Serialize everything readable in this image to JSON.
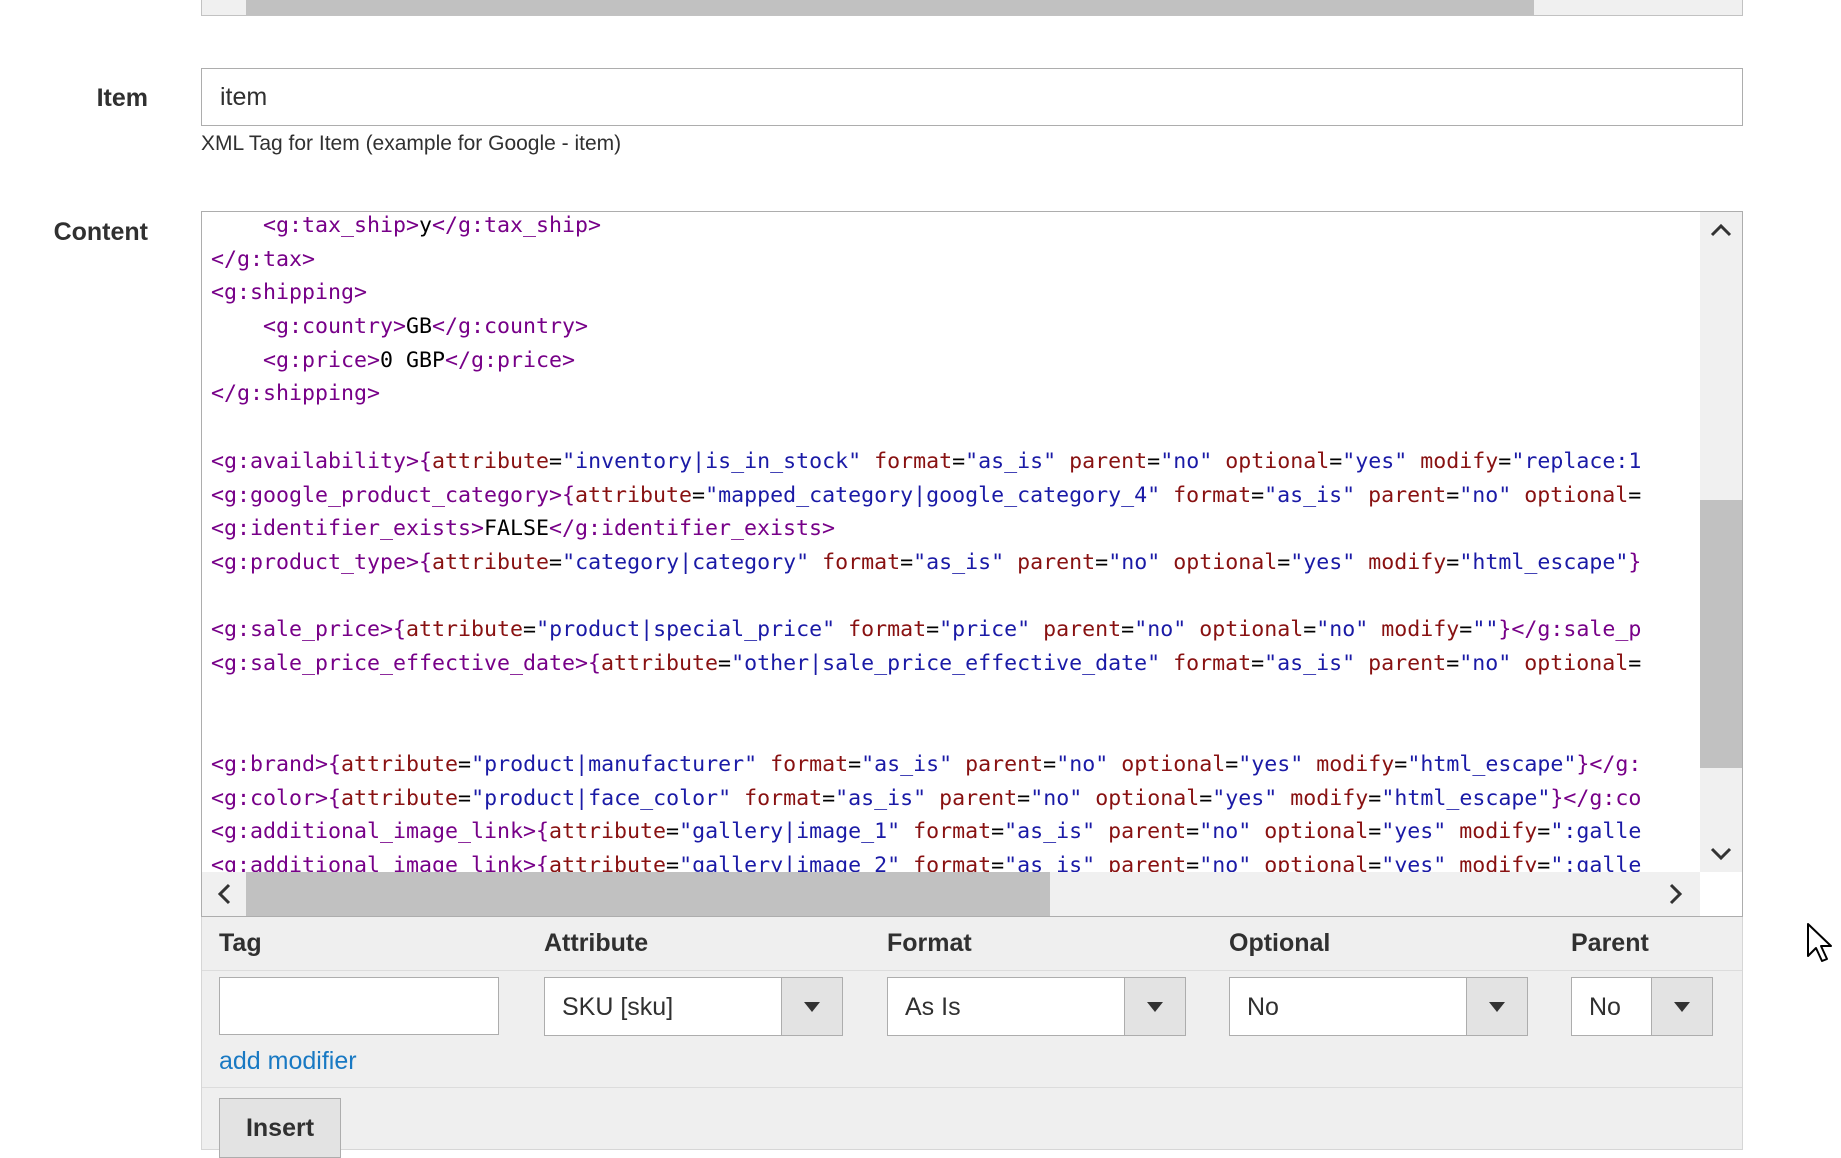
{
  "item_field": {
    "label": "Item",
    "value": "item",
    "note": "XML Tag for Item (example for Google - item)"
  },
  "content_field": {
    "label": "Content",
    "lines": [
      [
        {
          "t": "tag",
          "s": "    <g:tax_ship>"
        },
        {
          "t": "txt",
          "s": "y"
        },
        {
          "t": "tag",
          "s": "</g:tax_ship>"
        }
      ],
      [
        {
          "t": "tag",
          "s": "</g:tax>"
        }
      ],
      [
        {
          "t": "tag",
          "s": "<g:shipping>"
        }
      ],
      [
        {
          "t": "tag",
          "s": "    <g:country>"
        },
        {
          "t": "txt",
          "s": "GB"
        },
        {
          "t": "tag",
          "s": "</g:country>"
        }
      ],
      [
        {
          "t": "tag",
          "s": "    <g:price>"
        },
        {
          "t": "txt",
          "s": "0 GBP"
        },
        {
          "t": "tag",
          "s": "</g:price>"
        }
      ],
      [
        {
          "t": "tag",
          "s": "</g:shipping>"
        }
      ],
      [],
      [
        {
          "t": "tag",
          "s": "<g:availability>"
        },
        {
          "t": "brc",
          "s": "{"
        },
        {
          "t": "attr",
          "s": "attribute"
        },
        {
          "t": "eq",
          "s": "="
        },
        {
          "t": "str",
          "s": "\"inventory|is_in_stock\""
        },
        {
          "t": "txt",
          "s": " "
        },
        {
          "t": "attr",
          "s": "format"
        },
        {
          "t": "eq",
          "s": "="
        },
        {
          "t": "str",
          "s": "\"as_is\""
        },
        {
          "t": "txt",
          "s": " "
        },
        {
          "t": "attr",
          "s": "parent"
        },
        {
          "t": "eq",
          "s": "="
        },
        {
          "t": "str",
          "s": "\"no\""
        },
        {
          "t": "txt",
          "s": " "
        },
        {
          "t": "attr",
          "s": "optional"
        },
        {
          "t": "eq",
          "s": "="
        },
        {
          "t": "str",
          "s": "\"yes\""
        },
        {
          "t": "txt",
          "s": " "
        },
        {
          "t": "attr",
          "s": "modify"
        },
        {
          "t": "eq",
          "s": "="
        },
        {
          "t": "str",
          "s": "\"replace:1"
        }
      ],
      [
        {
          "t": "tag",
          "s": "<g:google_product_category>"
        },
        {
          "t": "brc",
          "s": "{"
        },
        {
          "t": "attr",
          "s": "attribute"
        },
        {
          "t": "eq",
          "s": "="
        },
        {
          "t": "str",
          "s": "\"mapped_category|google_category_4\""
        },
        {
          "t": "txt",
          "s": " "
        },
        {
          "t": "attr",
          "s": "format"
        },
        {
          "t": "eq",
          "s": "="
        },
        {
          "t": "str",
          "s": "\"as_is\""
        },
        {
          "t": "txt",
          "s": " "
        },
        {
          "t": "attr",
          "s": "parent"
        },
        {
          "t": "eq",
          "s": "="
        },
        {
          "t": "str",
          "s": "\"no\""
        },
        {
          "t": "txt",
          "s": " "
        },
        {
          "t": "attr",
          "s": "optional"
        },
        {
          "t": "eq",
          "s": "="
        }
      ],
      [
        {
          "t": "tag",
          "s": "<g:identifier_exists>"
        },
        {
          "t": "txt",
          "s": "FALSE"
        },
        {
          "t": "tag",
          "s": "</g:identifier_exists>"
        }
      ],
      [
        {
          "t": "tag",
          "s": "<g:product_type>"
        },
        {
          "t": "brc",
          "s": "{"
        },
        {
          "t": "attr",
          "s": "attribute"
        },
        {
          "t": "eq",
          "s": "="
        },
        {
          "t": "str",
          "s": "\"category|category\""
        },
        {
          "t": "txt",
          "s": " "
        },
        {
          "t": "attr",
          "s": "format"
        },
        {
          "t": "eq",
          "s": "="
        },
        {
          "t": "str",
          "s": "\"as_is\""
        },
        {
          "t": "txt",
          "s": " "
        },
        {
          "t": "attr",
          "s": "parent"
        },
        {
          "t": "eq",
          "s": "="
        },
        {
          "t": "str",
          "s": "\"no\""
        },
        {
          "t": "txt",
          "s": " "
        },
        {
          "t": "attr",
          "s": "optional"
        },
        {
          "t": "eq",
          "s": "="
        },
        {
          "t": "str",
          "s": "\"yes\""
        },
        {
          "t": "txt",
          "s": " "
        },
        {
          "t": "attr",
          "s": "modify"
        },
        {
          "t": "eq",
          "s": "="
        },
        {
          "t": "str",
          "s": "\"html_escape\""
        },
        {
          "t": "brc",
          "s": "}"
        }
      ],
      [],
      [
        {
          "t": "tag",
          "s": "<g:sale_price>"
        },
        {
          "t": "brc",
          "s": "{"
        },
        {
          "t": "attr",
          "s": "attribute"
        },
        {
          "t": "eq",
          "s": "="
        },
        {
          "t": "str",
          "s": "\"product|special_price\""
        },
        {
          "t": "txt",
          "s": " "
        },
        {
          "t": "attr",
          "s": "format"
        },
        {
          "t": "eq",
          "s": "="
        },
        {
          "t": "str",
          "s": "\"price\""
        },
        {
          "t": "txt",
          "s": " "
        },
        {
          "t": "attr",
          "s": "parent"
        },
        {
          "t": "eq",
          "s": "="
        },
        {
          "t": "str",
          "s": "\"no\""
        },
        {
          "t": "txt",
          "s": " "
        },
        {
          "t": "attr",
          "s": "optional"
        },
        {
          "t": "eq",
          "s": "="
        },
        {
          "t": "str",
          "s": "\"no\""
        },
        {
          "t": "txt",
          "s": " "
        },
        {
          "t": "attr",
          "s": "modify"
        },
        {
          "t": "eq",
          "s": "="
        },
        {
          "t": "str",
          "s": "\"\""
        },
        {
          "t": "brc",
          "s": "}"
        },
        {
          "t": "tag",
          "s": "</g:sale_p"
        }
      ],
      [
        {
          "t": "tag",
          "s": "<g:sale_price_effective_date>"
        },
        {
          "t": "brc",
          "s": "{"
        },
        {
          "t": "attr",
          "s": "attribute"
        },
        {
          "t": "eq",
          "s": "="
        },
        {
          "t": "str",
          "s": "\"other|sale_price_effective_date\""
        },
        {
          "t": "txt",
          "s": " "
        },
        {
          "t": "attr",
          "s": "format"
        },
        {
          "t": "eq",
          "s": "="
        },
        {
          "t": "str",
          "s": "\"as_is\""
        },
        {
          "t": "txt",
          "s": " "
        },
        {
          "t": "attr",
          "s": "parent"
        },
        {
          "t": "eq",
          "s": "="
        },
        {
          "t": "str",
          "s": "\"no\""
        },
        {
          "t": "txt",
          "s": " "
        },
        {
          "t": "attr",
          "s": "optional"
        },
        {
          "t": "eq",
          "s": "="
        }
      ],
      [],
      [],
      [
        {
          "t": "tag",
          "s": "<g:brand>"
        },
        {
          "t": "brc",
          "s": "{"
        },
        {
          "t": "attr",
          "s": "attribute"
        },
        {
          "t": "eq",
          "s": "="
        },
        {
          "t": "str",
          "s": "\"product|manufacturer\""
        },
        {
          "t": "txt",
          "s": " "
        },
        {
          "t": "attr",
          "s": "format"
        },
        {
          "t": "eq",
          "s": "="
        },
        {
          "t": "str",
          "s": "\"as_is\""
        },
        {
          "t": "txt",
          "s": " "
        },
        {
          "t": "attr",
          "s": "parent"
        },
        {
          "t": "eq",
          "s": "="
        },
        {
          "t": "str",
          "s": "\"no\""
        },
        {
          "t": "txt",
          "s": " "
        },
        {
          "t": "attr",
          "s": "optional"
        },
        {
          "t": "eq",
          "s": "="
        },
        {
          "t": "str",
          "s": "\"yes\""
        },
        {
          "t": "txt",
          "s": " "
        },
        {
          "t": "attr",
          "s": "modify"
        },
        {
          "t": "eq",
          "s": "="
        },
        {
          "t": "str",
          "s": "\"html_escape\""
        },
        {
          "t": "brc",
          "s": "}"
        },
        {
          "t": "tag",
          "s": "</g:"
        }
      ],
      [
        {
          "t": "tag",
          "s": "<g:color>"
        },
        {
          "t": "brc",
          "s": "{"
        },
        {
          "t": "attr",
          "s": "attribute"
        },
        {
          "t": "eq",
          "s": "="
        },
        {
          "t": "str",
          "s": "\"product|face_color\""
        },
        {
          "t": "txt",
          "s": " "
        },
        {
          "t": "attr",
          "s": "format"
        },
        {
          "t": "eq",
          "s": "="
        },
        {
          "t": "str",
          "s": "\"as_is\""
        },
        {
          "t": "txt",
          "s": " "
        },
        {
          "t": "attr",
          "s": "parent"
        },
        {
          "t": "eq",
          "s": "="
        },
        {
          "t": "str",
          "s": "\"no\""
        },
        {
          "t": "txt",
          "s": " "
        },
        {
          "t": "attr",
          "s": "optional"
        },
        {
          "t": "eq",
          "s": "="
        },
        {
          "t": "str",
          "s": "\"yes\""
        },
        {
          "t": "txt",
          "s": " "
        },
        {
          "t": "attr",
          "s": "modify"
        },
        {
          "t": "eq",
          "s": "="
        },
        {
          "t": "str",
          "s": "\"html_escape\""
        },
        {
          "t": "brc",
          "s": "}"
        },
        {
          "t": "tag",
          "s": "</g:co"
        }
      ],
      [
        {
          "t": "tag",
          "s": "<g:additional_image_link>"
        },
        {
          "t": "brc",
          "s": "{"
        },
        {
          "t": "attr",
          "s": "attribute"
        },
        {
          "t": "eq",
          "s": "="
        },
        {
          "t": "str",
          "s": "\"gallery|image_1\""
        },
        {
          "t": "txt",
          "s": " "
        },
        {
          "t": "attr",
          "s": "format"
        },
        {
          "t": "eq",
          "s": "="
        },
        {
          "t": "str",
          "s": "\"as_is\""
        },
        {
          "t": "txt",
          "s": " "
        },
        {
          "t": "attr",
          "s": "parent"
        },
        {
          "t": "eq",
          "s": "="
        },
        {
          "t": "str",
          "s": "\"no\""
        },
        {
          "t": "txt",
          "s": " "
        },
        {
          "t": "attr",
          "s": "optional"
        },
        {
          "t": "eq",
          "s": "="
        },
        {
          "t": "str",
          "s": "\"yes\""
        },
        {
          "t": "txt",
          "s": " "
        },
        {
          "t": "attr",
          "s": "modify"
        },
        {
          "t": "eq",
          "s": "="
        },
        {
          "t": "str",
          "s": "\":galle"
        }
      ],
      [
        {
          "t": "tag",
          "s": "<g:additional_image_link>"
        },
        {
          "t": "brc",
          "s": "{"
        },
        {
          "t": "attr",
          "s": "attribute"
        },
        {
          "t": "eq",
          "s": "="
        },
        {
          "t": "str",
          "s": "\"gallery|image_2\""
        },
        {
          "t": "txt",
          "s": " "
        },
        {
          "t": "attr",
          "s": "format"
        },
        {
          "t": "eq",
          "s": "="
        },
        {
          "t": "str",
          "s": "\"as_is\""
        },
        {
          "t": "txt",
          "s": " "
        },
        {
          "t": "attr",
          "s": "parent"
        },
        {
          "t": "eq",
          "s": "="
        },
        {
          "t": "str",
          "s": "\"no\""
        },
        {
          "t": "txt",
          "s": " "
        },
        {
          "t": "attr",
          "s": "optional"
        },
        {
          "t": "eq",
          "s": "="
        },
        {
          "t": "str",
          "s": "\"yes\""
        },
        {
          "t": "txt",
          "s": " "
        },
        {
          "t": "attr",
          "s": "modify"
        },
        {
          "t": "eq",
          "s": "="
        },
        {
          "t": "str",
          "s": "\":galle"
        }
      ]
    ]
  },
  "builder": {
    "headers": {
      "tag": "Tag",
      "attribute": "Attribute",
      "format": "Format",
      "optional": "Optional",
      "parent": "Parent"
    },
    "tag_value": "",
    "attribute_value": "SKU [sku]",
    "format_value": "As Is",
    "optional_value": "No",
    "parent_value": "No",
    "add_modifier": "add modifier",
    "insert_label": "Insert"
  },
  "colors": {
    "tag": "#770088",
    "attribute": "#881111",
    "string": "#1a1aa6",
    "link": "#1979c3"
  },
  "icons": [
    "chevron-up-icon",
    "chevron-down-icon",
    "chevron-left-icon",
    "chevron-right-icon",
    "dropdown-arrow-icon",
    "mouse-cursor-icon"
  ]
}
